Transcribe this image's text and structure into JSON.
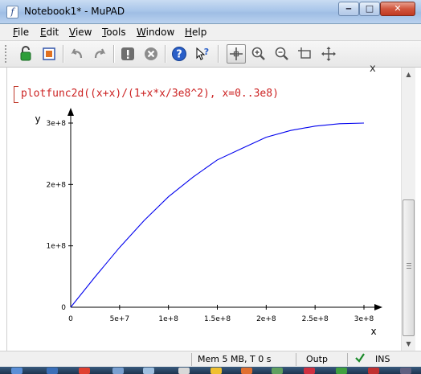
{
  "window": {
    "title": "Notebook1* - MuPAD",
    "app_icon": "f",
    "controls": {
      "minimize": "‒",
      "maximize": "□",
      "close": "✕"
    }
  },
  "menu": {
    "items": [
      {
        "accel": "F",
        "rest": "ile"
      },
      {
        "accel": "E",
        "rest": "dit"
      },
      {
        "accel": "V",
        "rest": "iew"
      },
      {
        "accel": "T",
        "rest": "ools"
      },
      {
        "accel": "W",
        "rest": "indow"
      },
      {
        "accel": "H",
        "rest": "elp"
      }
    ]
  },
  "toolbar": {
    "buttons": [
      "open-notebook-icon",
      "export-icon",
      "undo-icon",
      "redo-icon",
      "evaluate-icon",
      "stop-icon",
      "help-icon",
      "context-help-icon",
      "select-icon",
      "zoom-in-icon",
      "zoom-out-icon",
      "zoom-box-icon",
      "move-icon"
    ],
    "active": "select-icon"
  },
  "document": {
    "command": "plotfunc2d((x+x)/(1+x*x/3e8^2), x=0..3e8)",
    "collapse_glyph": "x"
  },
  "chart_data": {
    "type": "line",
    "title": "",
    "xlabel": "x",
    "ylabel": "y",
    "function": "(x+x)/(1+x*x/3e8^2)",
    "xlim": [
      0,
      300000000
    ],
    "ylim": [
      0,
      300000000
    ],
    "x_ticks": [
      0,
      50000000,
      100000000,
      150000000,
      200000000,
      250000000,
      300000000
    ],
    "x_tick_labels": [
      "0",
      "5e+7",
      "1e+8",
      "1.5e+8",
      "2e+8",
      "2.5e+8",
      "3e+8"
    ],
    "y_ticks": [
      0,
      100000000,
      200000000,
      300000000
    ],
    "y_tick_labels": [
      "0",
      "1e+8",
      "2e+8",
      "3e+8"
    ],
    "grid": false,
    "series": [
      {
        "color": "#0000ee",
        "x": [
          0,
          25000000,
          50000000,
          75000000,
          100000000,
          125000000,
          150000000,
          175000000,
          200000000,
          225000000,
          250000000,
          275000000,
          300000000
        ],
        "y": [
          0,
          49655000,
          97297000,
          141176000,
          180000000,
          211864000,
          240000000,
          258599000,
          276923000,
          288000000,
          295082000,
          298969000,
          300000000
        ]
      }
    ]
  },
  "status": {
    "memory": "Mem 5 MB, T 0 s",
    "output": "Outp",
    "mode": "INS"
  }
}
